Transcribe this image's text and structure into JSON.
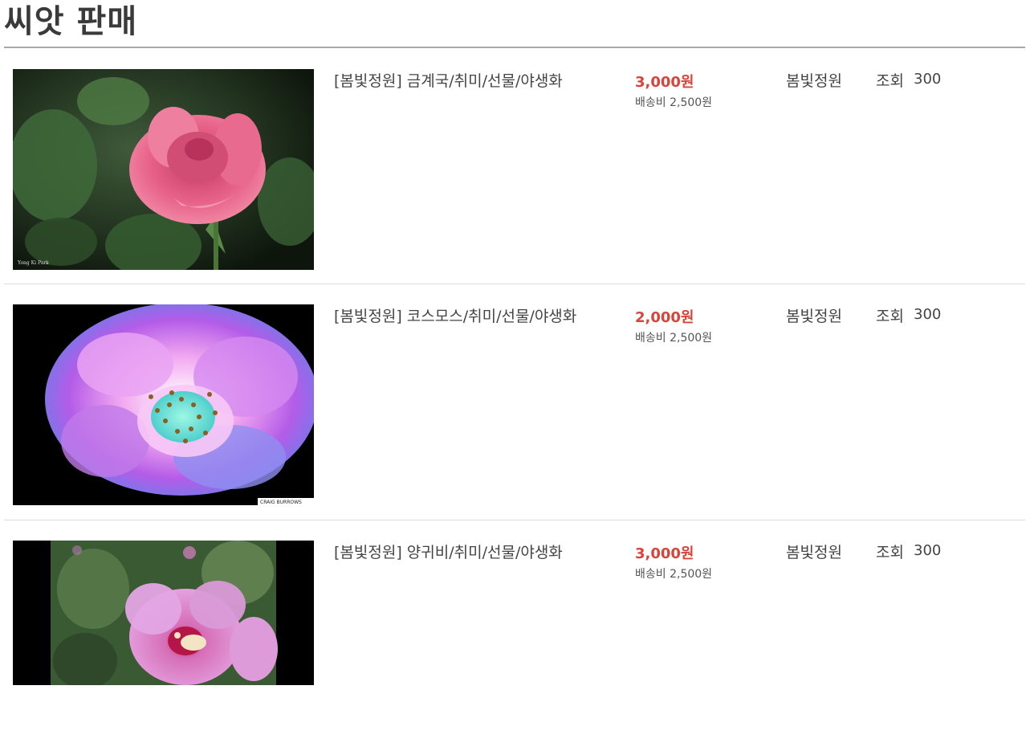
{
  "page": {
    "title": "씨앗 판매"
  },
  "products": [
    {
      "name": "[봄빛정원] 금계국/취미/선물/야생화",
      "price": "3,000원",
      "shipping": "배송비 2,500원",
      "seller": "봄빛정원",
      "views_label": "조회",
      "views": "300",
      "image_icon": "pink-rose-photo",
      "watermark": "Yong Ki Park"
    },
    {
      "name": "[봄빛정원] 코스모스/취미/선물/야생화",
      "price": "2,000원",
      "shipping": "배송비 2,500원",
      "seller": "봄빛정원",
      "views_label": "조회",
      "views": "300",
      "image_icon": "purple-flower-photo",
      "watermark": "CRAIG BURROWS"
    },
    {
      "name": "[봄빛정원] 양귀비/취미/선물/야생화",
      "price": "3,000원",
      "shipping": "배송비 2,500원",
      "seller": "봄빛정원",
      "views_label": "조회",
      "views": "300",
      "image_icon": "hibiscus-photo"
    }
  ],
  "colors": {
    "price": "#d9443a",
    "title_rule": "#a8a8a8",
    "divider": "#dddddd"
  }
}
